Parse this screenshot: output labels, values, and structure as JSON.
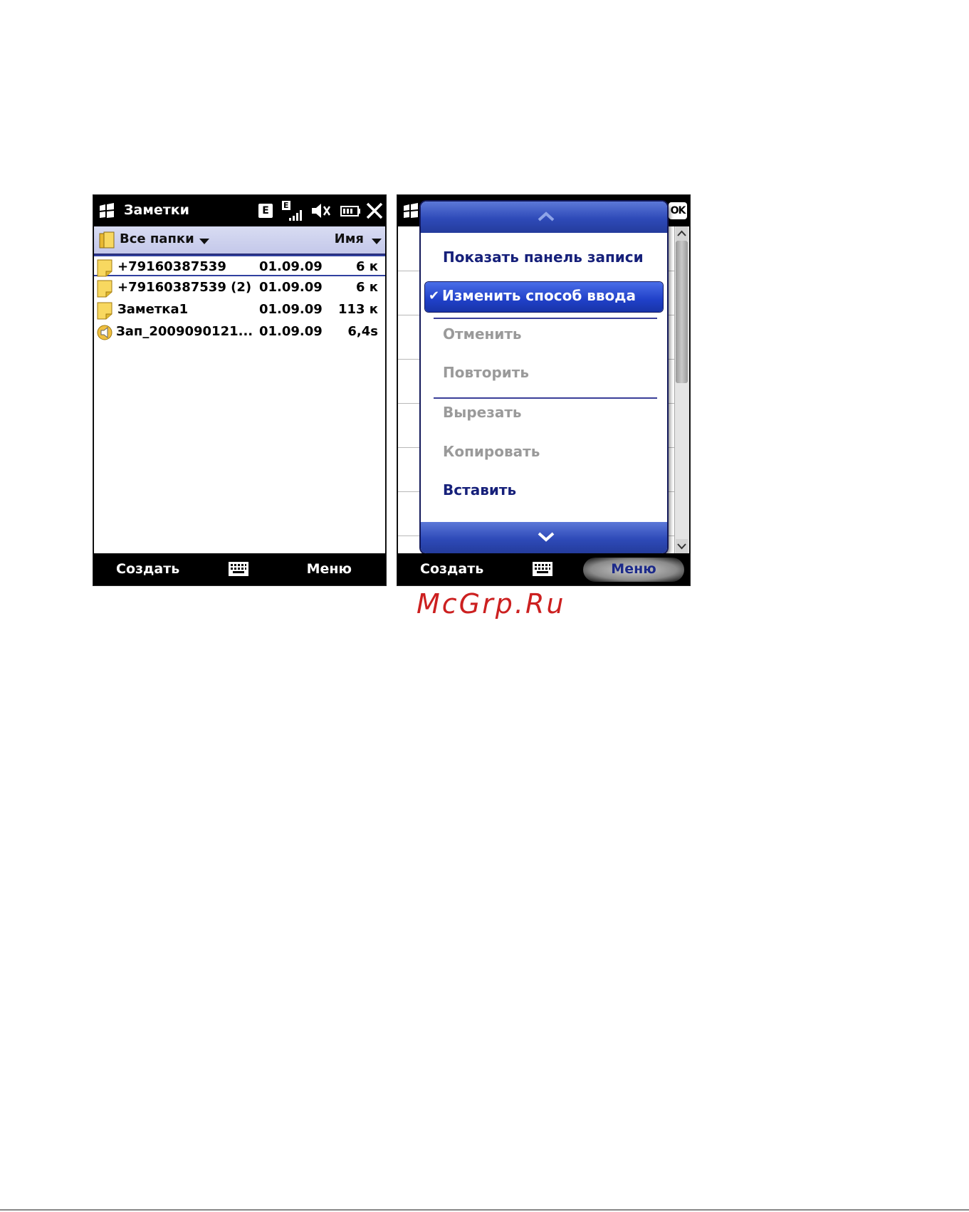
{
  "screen1": {
    "title": "Заметки",
    "status": {
      "network_letter": "E",
      "signal_letter": "E"
    },
    "folder_label": "Все папки",
    "sort_label": "Имя",
    "rows": [
      {
        "name": "+79160387539",
        "date": "01.09.09",
        "size": "6 к",
        "icon": "note-icon",
        "selected": true
      },
      {
        "name": "+79160387539 (2)",
        "date": "01.09.09",
        "size": "6 к",
        "icon": "note-icon",
        "selected": false
      },
      {
        "name": "Заметка1",
        "date": "01.09.09",
        "size": "113 к",
        "icon": "note-icon",
        "selected": false
      },
      {
        "name": "Зап_2009090121...",
        "date": "01.09.09",
        "size": "6,4s",
        "icon": "voice-recording-icon",
        "selected": false
      }
    ],
    "softkeys": {
      "left": "Создать",
      "right": "Меню"
    }
  },
  "screen2": {
    "ok_label": "OK",
    "menu": {
      "items": [
        {
          "label": "Показать панель записи",
          "enabled": true
        },
        {
          "label": "Изменить способ ввода",
          "enabled": true,
          "checked": true,
          "highlighted": true
        },
        {
          "label": "Отменить",
          "enabled": false
        },
        {
          "label": "Повторить",
          "enabled": false
        },
        {
          "label": "Вырезать",
          "enabled": false
        },
        {
          "label": "Копировать",
          "enabled": false
        },
        {
          "label": "Вставить",
          "enabled": true
        }
      ],
      "check_mark": "✔"
    },
    "softkeys": {
      "left": "Создать",
      "right": "Меню"
    }
  },
  "watermark": "McGrp.Ru",
  "colors": {
    "menu_accent": "#2e4ab8",
    "menu_text": "#16207a",
    "disabled_text": "#9a9a9a",
    "watermark": "#cc2020"
  }
}
